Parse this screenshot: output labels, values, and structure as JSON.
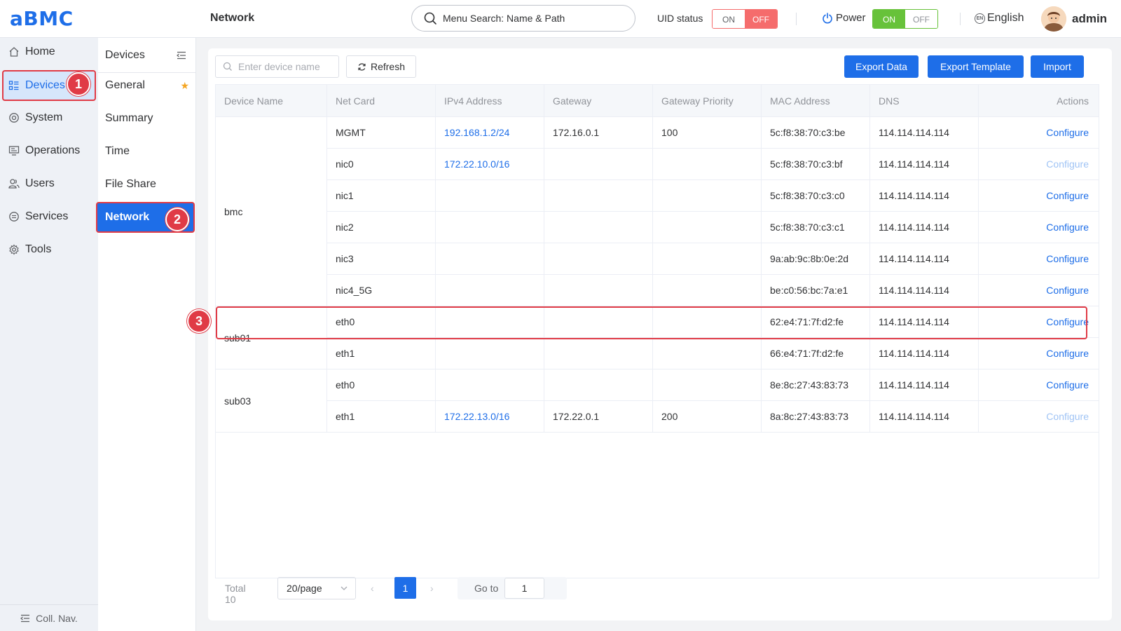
{
  "header": {
    "logo": "aBMC",
    "page_title": "Network",
    "menu_search_placeholder": "Menu Search: Name & Path",
    "uid_label": "UID status",
    "uid_on": "ON",
    "uid_off": "OFF",
    "power_label": "Power",
    "power_on": "ON",
    "power_off": "OFF",
    "language_icon_text": "EN",
    "language": "English",
    "user": "admin"
  },
  "sidebar": {
    "items": [
      {
        "label": "Home",
        "icon": "home-icon"
      },
      {
        "label": "Devices",
        "icon": "devices-icon",
        "active": true
      },
      {
        "label": "System",
        "icon": "system-icon"
      },
      {
        "label": "Operations",
        "icon": "operations-icon"
      },
      {
        "label": "Users",
        "icon": "users-icon"
      },
      {
        "label": "Services",
        "icon": "services-icon"
      },
      {
        "label": "Tools",
        "icon": "tools-icon"
      }
    ],
    "collapse_label": "Coll. Nav."
  },
  "submenu": {
    "title": "Devices",
    "items": [
      {
        "label": "General",
        "starred": true
      },
      {
        "label": "Summary"
      },
      {
        "label": "Time"
      },
      {
        "label": "File Share"
      },
      {
        "label": "Network",
        "active": true
      }
    ]
  },
  "annotations": [
    "1",
    "2",
    "3"
  ],
  "toolbar": {
    "search_placeholder": "Enter device name",
    "refresh_label": "Refresh",
    "export_data_label": "Export Data",
    "export_template_label": "Export Template",
    "import_label": "Import"
  },
  "table": {
    "columns": [
      "Device Name",
      "Net Card",
      "IPv4 Address",
      "Gateway",
      "Gateway Priority",
      "MAC Address",
      "DNS",
      "Actions"
    ],
    "groups": [
      {
        "device": "bmc",
        "rows": [
          0,
          1,
          2,
          3,
          4,
          5
        ]
      },
      {
        "device": "sub01",
        "rows": [
          6,
          7
        ]
      },
      {
        "device": "sub03",
        "rows": [
          8,
          9
        ]
      }
    ],
    "rows": [
      {
        "net_card": "MGMT",
        "ipv4": "192.168.1.2/24",
        "gateway": "172.16.0.1",
        "priority": "100",
        "mac": "5c:f8:38:70:c3:be",
        "dns": "114.114.114.114",
        "action": "Configure",
        "action_enabled": true
      },
      {
        "net_card": "nic0",
        "ipv4": "172.22.10.0/16",
        "gateway": "",
        "priority": "",
        "mac": "5c:f8:38:70:c3:bf",
        "dns": "114.114.114.114",
        "action": "Configure",
        "action_enabled": false
      },
      {
        "net_card": "nic1",
        "ipv4": "",
        "gateway": "",
        "priority": "",
        "mac": "5c:f8:38:70:c3:c0",
        "dns": "114.114.114.114",
        "action": "Configure",
        "action_enabled": true
      },
      {
        "net_card": "nic2",
        "ipv4": "",
        "gateway": "",
        "priority": "",
        "mac": "5c:f8:38:70:c3:c1",
        "dns": "114.114.114.114",
        "action": "Configure",
        "action_enabled": true
      },
      {
        "net_card": "nic3",
        "ipv4": "",
        "gateway": "",
        "priority": "",
        "mac": "9a:ab:9c:8b:0e:2d",
        "dns": "114.114.114.114",
        "action": "Configure",
        "action_enabled": true
      },
      {
        "net_card": "nic4_5G",
        "ipv4": "",
        "gateway": "",
        "priority": "",
        "mac": "be:c0:56:bc:7a:e1",
        "dns": "114.114.114.114",
        "action": "Configure",
        "action_enabled": true
      },
      {
        "net_card": "eth0",
        "ipv4": "",
        "gateway": "",
        "priority": "",
        "mac": "62:e4:71:7f:d2:fe",
        "dns": "114.114.114.114",
        "action": "Configure",
        "action_enabled": true
      },
      {
        "net_card": "eth1",
        "ipv4": "",
        "gateway": "",
        "priority": "",
        "mac": "66:e4:71:7f:d2:fe",
        "dns": "114.114.114.114",
        "action": "Configure",
        "action_enabled": true
      },
      {
        "net_card": "eth0",
        "ipv4": "",
        "gateway": "",
        "priority": "",
        "mac": "8e:8c:27:43:83:73",
        "dns": "114.114.114.114",
        "action": "Configure",
        "action_enabled": true
      },
      {
        "net_card": "eth1",
        "ipv4": "172.22.13.0/16",
        "gateway": "172.22.0.1",
        "priority": "200",
        "mac": "8a:8c:27:43:83:73",
        "dns": "114.114.114.114",
        "action": "Configure",
        "action_enabled": false
      }
    ]
  },
  "pagination": {
    "total": "Total 10",
    "page_size": "20/page",
    "current_page": "1",
    "goto_label": "Go to",
    "goto_value": "1"
  },
  "colors": {
    "primary": "#1e6ee8",
    "danger": "#e03b46",
    "success": "#67c23a",
    "off_red": "#f56c6c"
  }
}
